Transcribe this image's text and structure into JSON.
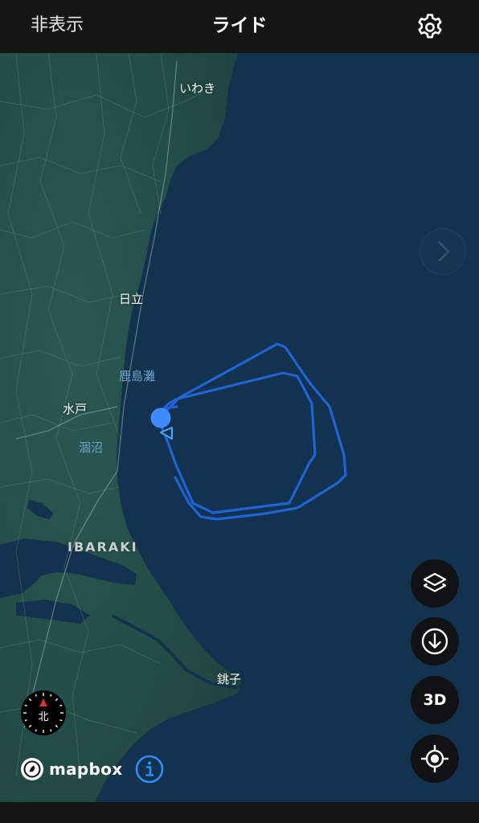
{
  "header": {
    "hide_label": "非表示",
    "title": "ライド"
  },
  "map": {
    "labels": {
      "iwaki": "いわき",
      "hitachi": "日立",
      "kashimanada": "鹿島灘",
      "mito": "水戸",
      "hinuma": "涸沼",
      "ibaraki": "IBARAKI",
      "choshi": "銚子"
    },
    "compass_label": "北",
    "mapbox_label": "mapbox",
    "route_color": "#1f63d6",
    "position_color": "#3f8cff",
    "land_color": "#244d48",
    "water_color": "#13324e"
  },
  "controls": {
    "layers": "layers-icon",
    "download": "download-icon",
    "three_d_label": "3D",
    "locate": "locate-icon"
  }
}
